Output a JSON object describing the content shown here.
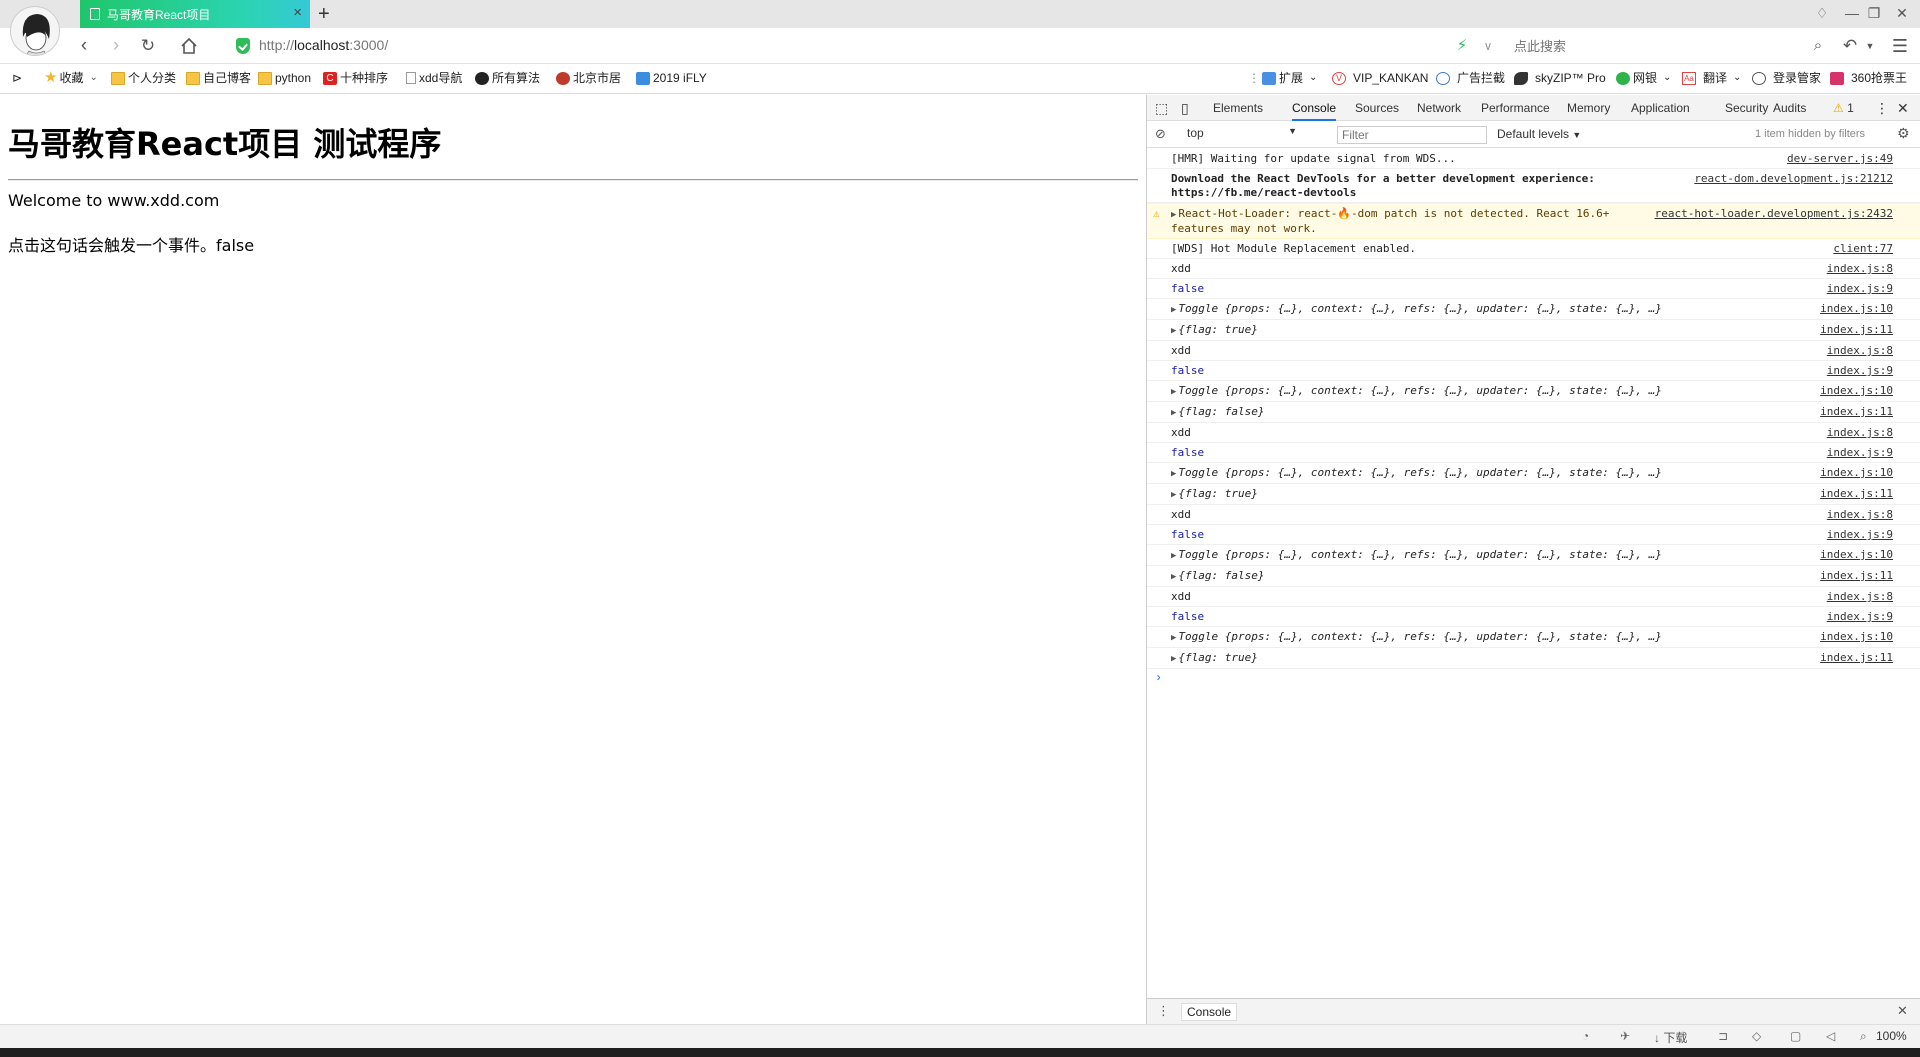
{
  "browser": {
    "tab_title": "马哥教育React项目",
    "url_scheme": "http://",
    "url_host": "localhost",
    "url_rest": ":3000/",
    "search_placeholder": "点此搜索",
    "bookmarks": [
      {
        "label": "收藏",
        "icon": "star-icon"
      },
      {
        "label": "个人分类",
        "icon": "folder-icon"
      },
      {
        "label": "自己博客",
        "icon": "folder-icon"
      },
      {
        "label": "python",
        "icon": "folder-icon"
      },
      {
        "label": "十种排序",
        "icon": "c-logo-icon"
      },
      {
        "label": "xdd导航",
        "icon": "page-icon"
      },
      {
        "label": "所有算法",
        "icon": "github-icon"
      },
      {
        "label": "北京市居",
        "icon": "site-icon"
      },
      {
        "label": "2019 iFLY",
        "icon": "ifly-icon"
      }
    ],
    "extensions": [
      {
        "label": "扩展"
      },
      {
        "label": "VIP_KANKAN"
      },
      {
        "label": "广告拦截"
      },
      {
        "label": "skyZIP™ Pro"
      },
      {
        "label": "网银"
      },
      {
        "label": "翻译"
      },
      {
        "label": "登录管家"
      },
      {
        "label": "360抢票王"
      }
    ],
    "status_download": "下载",
    "zoom": "100%"
  },
  "page": {
    "heading": "马哥教育React项目 测试程序",
    "welcome": "Welcome to www.xdd.com",
    "click_text": "点击这句话会触发一个事件。false"
  },
  "devtools": {
    "tabs": [
      "Elements",
      "Console",
      "Sources",
      "Network",
      "Performance",
      "Memory",
      "Application",
      "Security",
      "Audits"
    ],
    "warning_count": "1",
    "context": "top",
    "filter_placeholder": "Filter",
    "levels": "Default levels",
    "hidden_info": "1 item hidden by filters",
    "drawer_tab": "Console",
    "logs": [
      {
        "text": "[HMR] Waiting for update signal from WDS...",
        "src": "dev-server.js:49"
      },
      {
        "text": "Download the React DevTools for a better development experience: https://fb.me/react-devtools",
        "src": "react-dom.development.js:21212",
        "bold": true
      },
      {
        "text": "React-Hot-Loader: react-🔥-dom patch is not detected. React 16.6+ features may not work.",
        "src": "react-hot-loader.development.js:2432",
        "warn": true
      },
      {
        "text": "[WDS] Hot Module Replacement enabled.",
        "src": "client:77"
      },
      {
        "text": "xdd",
        "src": "index.js:8"
      },
      {
        "text": "false",
        "src": "index.js:9",
        "kind": "bool"
      },
      {
        "text": "Toggle {props: {…}, context: {…}, refs: {…}, updater: {…}, state: {…}, …}",
        "src": "index.js:10",
        "kind": "obj"
      },
      {
        "text": "{flag: true}",
        "src": "index.js:11",
        "kind": "obj"
      },
      {
        "text": "xdd",
        "src": "index.js:8"
      },
      {
        "text": "false",
        "src": "index.js:9",
        "kind": "bool"
      },
      {
        "text": "Toggle {props: {…}, context: {…}, refs: {…}, updater: {…}, state: {…}, …}",
        "src": "index.js:10",
        "kind": "obj"
      },
      {
        "text": "{flag: false}",
        "src": "index.js:11",
        "kind": "obj"
      },
      {
        "text": "xdd",
        "src": "index.js:8"
      },
      {
        "text": "false",
        "src": "index.js:9",
        "kind": "bool"
      },
      {
        "text": "Toggle {props: {…}, context: {…}, refs: {…}, updater: {…}, state: {…}, …}",
        "src": "index.js:10",
        "kind": "obj"
      },
      {
        "text": "{flag: true}",
        "src": "index.js:11",
        "kind": "obj"
      },
      {
        "text": "xdd",
        "src": "index.js:8"
      },
      {
        "text": "false",
        "src": "index.js:9",
        "kind": "bool"
      },
      {
        "text": "Toggle {props: {…}, context: {…}, refs: {…}, updater: {…}, state: {…}, …}",
        "src": "index.js:10",
        "kind": "obj"
      },
      {
        "text": "{flag: false}",
        "src": "index.js:11",
        "kind": "obj"
      },
      {
        "text": "xdd",
        "src": "index.js:8"
      },
      {
        "text": "false",
        "src": "index.js:9",
        "kind": "bool"
      },
      {
        "text": "Toggle {props: {…}, context: {…}, refs: {…}, updater: {…}, state: {…}, …}",
        "src": "index.js:10",
        "kind": "obj"
      },
      {
        "text": "{flag: true}",
        "src": "index.js:11",
        "kind": "obj"
      }
    ]
  }
}
